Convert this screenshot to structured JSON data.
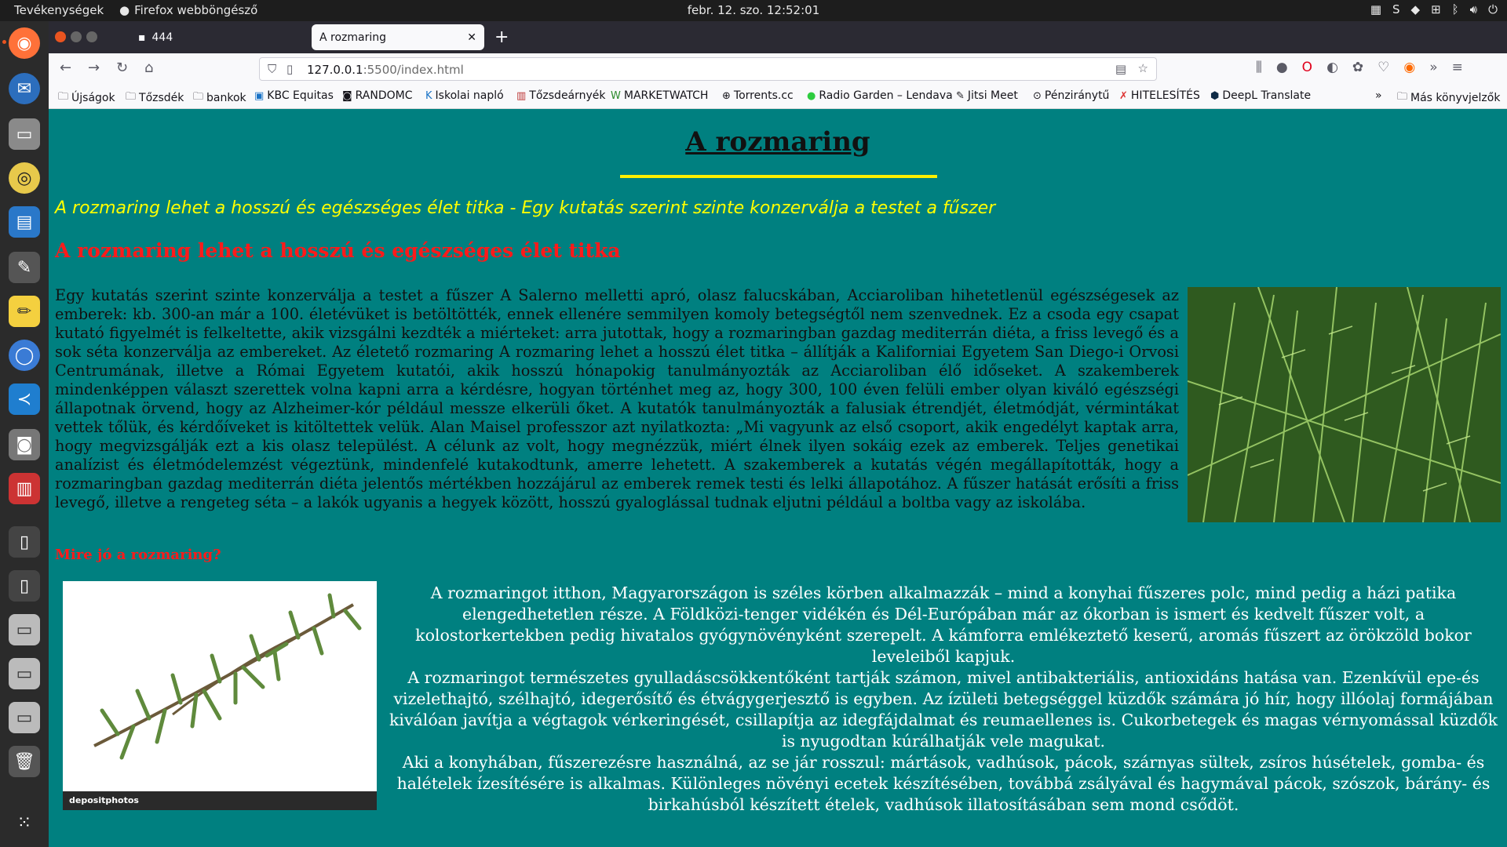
{
  "topbar": {
    "activities": "Tevékenységek",
    "app_name": "Firefox webböngésző",
    "clock": "febr. 12. szo.  12:52:01"
  },
  "dock": {
    "items": [
      "firefox-icon",
      "thunderbird-icon",
      "files-icon",
      "rhythmbox-icon",
      "writer-icon",
      "gimp-icon",
      "text-editor-icon",
      "chromium-icon",
      "vscode-icon",
      "camera-icon",
      "document-viewer-icon",
      "usb-drive-icon",
      "usb-drive-icon",
      "drive-icon",
      "drive-icon",
      "drive-icon",
      "trash-icon",
      "app-grid-icon"
    ]
  },
  "browser": {
    "tabs": [
      {
        "label": "444",
        "active": false
      },
      {
        "label": "A rozmaring",
        "active": true
      }
    ],
    "url_host": "127.0.0.1",
    "url_rest": ":5500/index.html",
    "bookmarks": [
      {
        "label": "Újságok",
        "icon": "folder-icon"
      },
      {
        "label": "Tőzsdék",
        "icon": "folder-icon"
      },
      {
        "label": "bankok",
        "icon": "folder-icon"
      },
      {
        "label": "KBC Equitas",
        "icon": "kbc-icon"
      },
      {
        "label": "RANDOMC",
        "icon": "randomc-icon"
      },
      {
        "label": "Iskolai napló",
        "icon": "kreta-icon"
      },
      {
        "label": "Tőzsdeárnyék",
        "icon": "chart-icon"
      },
      {
        "label": "MARKETWATCH",
        "icon": "marketwatch-icon"
      },
      {
        "label": "Torrents.cc",
        "icon": "globe-icon"
      },
      {
        "label": "Radio Garden – Lendava",
        "icon": "radio-icon"
      },
      {
        "label": "Jitsi Meet",
        "icon": "jitsi-icon"
      },
      {
        "label": "Pénziránytű",
        "icon": "compass-icon"
      },
      {
        "label": "HITELESÍTÉS",
        "icon": "sign-icon"
      },
      {
        "label": "DeepL Translate",
        "icon": "deepl-icon"
      }
    ],
    "other_bookmarks": "Más könyvjelzők"
  },
  "page": {
    "title": "A rozmaring",
    "subtitle": "A rozmaring lehet a hosszú és egészséges élet titka - Egy kutatás szerint szinte konzerválja a testet a fűszer",
    "heading2": "A rozmaring lehet a hosszú és egészséges élet titka",
    "paragraph1": "Egy kutatás szerint szinte konzerválja a testet a fűszer A Salerno melletti apró, olasz falucskában, Acciaroliban hihetetlenül egészségesek az emberek: kb. 300-an már a 100. életévüket is betöltötték, ennek ellenére semmilyen komoly betegségtől nem szenvednek. Ez a csoda egy csapat kutató figyelmét is felkeltette, akik vizsgálni kezdték a miérteket: arra jutottak, hogy a rozmaringban gazdag mediterrán diéta, a friss levegő és a sok séta konzerválja az embereket. Az életető rozmaring A rozmaring lehet a hosszú élet titka – állítják a Kaliforniai Egyetem San Diego-i Orvosi Centrumának, illetve a Római Egyetem kutatói, akik hosszú hónapokig tanulmányozták az Acciaroliban élő időseket. A szakemberek mindenképpen választ szerettek volna kapni arra a kérdésre, hogyan történhet meg az, hogy 300, 100 éven felüli ember olyan kiváló egészségi állapotnak örvend, hogy az Alzheimer-kór például messze elkerüli őket. A kutatók tanulmányozták a falusiak étrendjét, életmódját, vérmintákat vettek tőlük, és kérdőíveket is kitöltettek velük. Alan Maisel professzor azt nyilatkozta: „Mi vagyunk az első csoport, akik engedélyt kaptak arra, hogy megvizsgálják ezt a kis olasz települést. A célunk az volt, hogy megnézzük, miért élnek ilyen sokáig ezek az emberek. Teljes genetikai analízist és életmódelemzést végeztünk, mindenfelé kutakodtunk, amerre lehetett. A szakemberek a kutatás végén megállapították, hogy a rozmaringban gazdag mediterrán diéta jelentős mértékben hozzájárul az emberek remek testi és lelki állapotához. A fűszer hatását erősíti a friss levegő, illetve a rengeteg séta – a lakók ugyanis a hegyek között, hosszú gyaloglással tudnak eljutni például a boltba vagy az iskolába.",
    "heading3": "Mire jó a rozmaring?",
    "image_watermark": "depositphotos",
    "paragraph2a": "A rozmaringot itthon, Magyarországon is széles körben alkalmazzák – mind a konyhai fűszeres polc, mind pedig a házi patika elengedhetetlen része. A Földközi-tenger vidékén és Dél-Európában már az ókorban is ismert és kedvelt fűszer volt, a kolostorkertekben pedig hivatalos gyógynövényként szerepelt. A kámforra emlékeztető keserű, aromás fűszert az örökzöld bokor leveleiből kapjuk.",
    "paragraph2b": "A rozmaringot természetes gyulladáscsökkentőként tartják számon, mivel antibakteriális, antioxidáns hatása van. Ezenkívül epe-és vizelethajtó, szélhajtó, idegerősítő és étvágygerjesztő is egyben. Az ízületi betegséggel küzdők számára jó hír, hogy illóolaj formájában kiválóan javítja a végtagok vérkeringését, csillapítja az idegfájdalmat és reumaellenes is. Cukorbetegek és magas vérnyomással küzdők is nyugodtan kúrálhatják vele magukat.",
    "paragraph2c": "Aki a konyhában, fűszerezésre használná, az se jár rosszul: mártások, vadhúsok, pácok, szárnyas sültek, zsíros húsételek, gomba- és halételek ízesítésére is alkalmas. Különleges növényi ecetek készítésében, továbbá zsályával és hagymával pácok, szószok, bárány- és birkahúsból készített ételek, vadhúsok illatosításában sem mond csődöt."
  },
  "colors": {
    "page_bg": "#008080",
    "title_rule": "#ffef00",
    "subtitle": "#ffff00",
    "heading_red": "#ff1a1a"
  }
}
